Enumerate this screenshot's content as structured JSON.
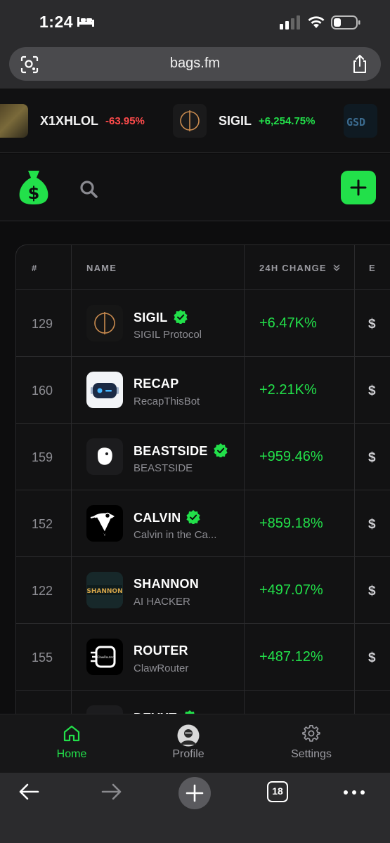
{
  "status": {
    "time": "1:24"
  },
  "browser": {
    "url": "bags.fm",
    "tab_count": "18"
  },
  "ticker": [
    {
      "name": "X1XHLOL",
      "change": "-63.95%",
      "color": "#ff4b4b"
    },
    {
      "name": "SIGIL",
      "change": "+6,254.75%",
      "color": "#22e04a"
    }
  ],
  "table": {
    "headers": {
      "rank": "#",
      "name": "NAME",
      "change": "24H CHANGE"
    },
    "rows": [
      {
        "rank": "129",
        "name": "SIGIL",
        "sub": "SIGIL Protocol",
        "verified": true,
        "change": "+6.47K%",
        "price": "$",
        "icon": "sigil-icon"
      },
      {
        "rank": "160",
        "name": "RECAP",
        "sub": "RecapThisBot",
        "verified": false,
        "change": "+2.21K%",
        "price": "$",
        "icon": "robot-icon"
      },
      {
        "rank": "159",
        "name": "BEASTSIDE",
        "sub": "BEASTSIDE",
        "verified": true,
        "change": "+959.46%",
        "price": "$",
        "icon": "beast-icon"
      },
      {
        "rank": "152",
        "name": "CALVIN",
        "sub": "Calvin in the Ca...",
        "verified": true,
        "change": "+859.18%",
        "price": "$",
        "icon": "bird-icon"
      },
      {
        "rank": "122",
        "name": "SHANNON",
        "sub": "AI HACKER",
        "verified": false,
        "change": "+497.07%",
        "price": "$",
        "icon": "shannon-logo"
      },
      {
        "rank": "155",
        "name": "ROUTER",
        "sub": "ClawRouter",
        "verified": false,
        "change": "+487.12%",
        "price": "$",
        "icon": "router-icon"
      },
      {
        "rank": "",
        "name": "DEVXT",
        "sub": "",
        "verified": true,
        "change": "",
        "price": "",
        "icon": ""
      }
    ]
  },
  "nav": {
    "home": "Home",
    "profile": "Profile",
    "settings": "Settings"
  },
  "colors": {
    "accent": "#22e04a",
    "negative": "#ff4b4b",
    "background": "#0d0d0e"
  }
}
